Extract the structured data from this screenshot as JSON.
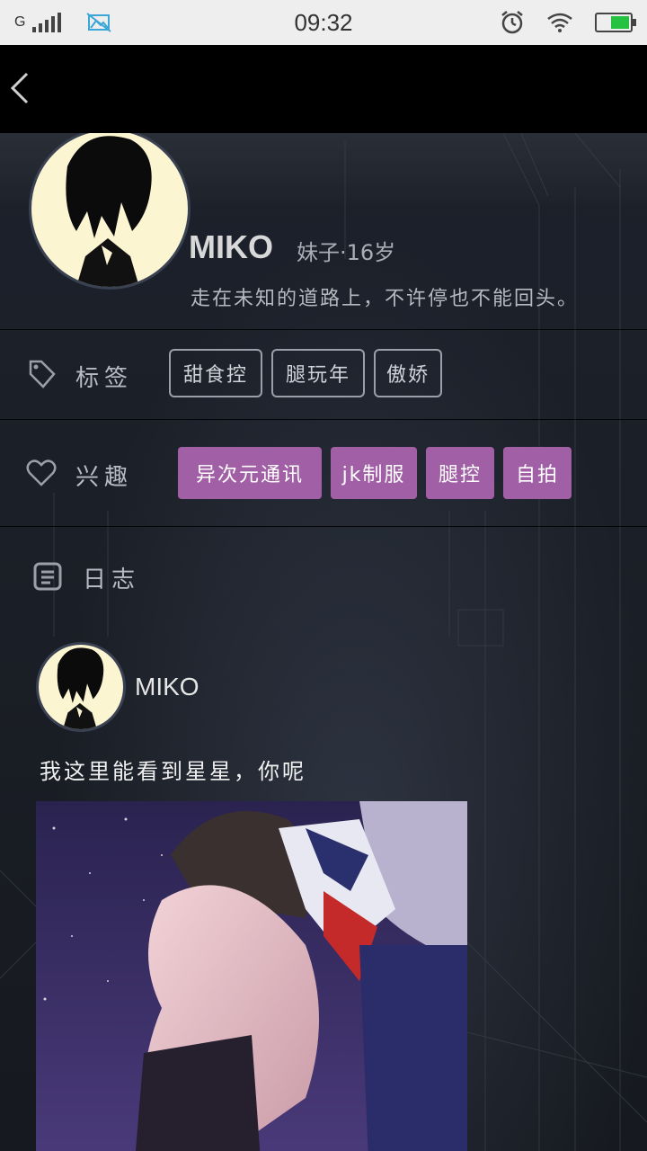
{
  "status_bar": {
    "carrier": "G",
    "time": "09:32",
    "battery_level": 0.6,
    "icons": [
      "signal-icon",
      "gallery-icon",
      "alarm-icon",
      "wifi-icon",
      "battery-icon"
    ]
  },
  "nav": {
    "back_icon": "back-arrow-icon"
  },
  "profile": {
    "name": "MIKO",
    "meta": "妹子·16岁",
    "motto": "走在未知的道路上，不许停也不能回头。"
  },
  "tags": {
    "label": "标签",
    "icon": "tag-icon",
    "items": [
      "甜食控",
      "腿玩年",
      "傲娇"
    ]
  },
  "interests": {
    "label": "兴趣",
    "icon": "heart-icon",
    "chip_color": "#a15fa6",
    "items": [
      "异次元通讯",
      "jk制服",
      "腿控",
      "自拍"
    ]
  },
  "journal": {
    "label": "日志",
    "icon": "journal-icon"
  },
  "post": {
    "author": "MIKO",
    "text": "我这里能看到星星，你呢"
  }
}
